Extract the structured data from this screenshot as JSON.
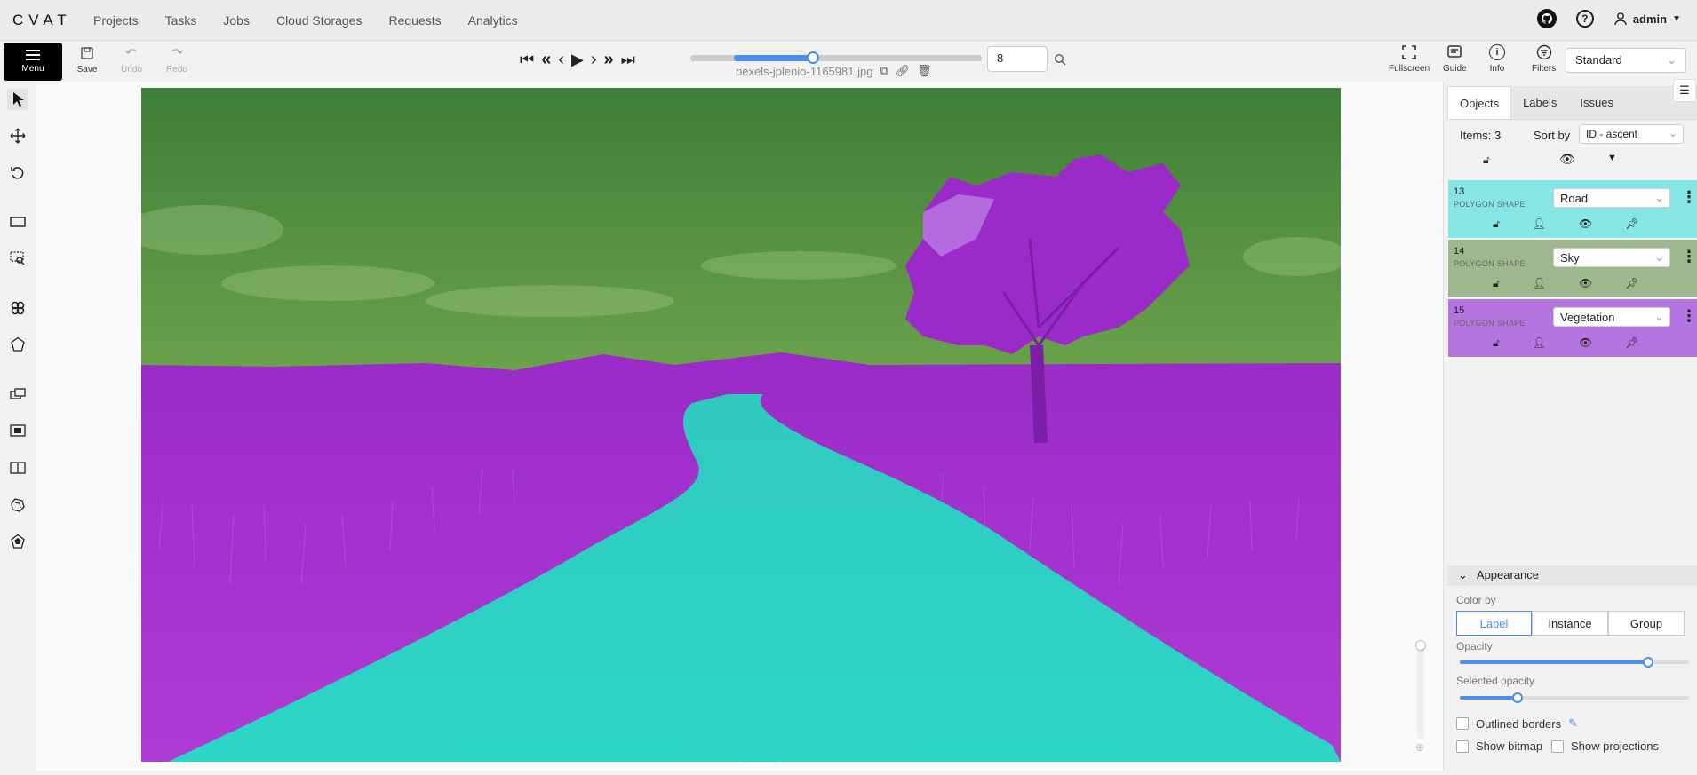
{
  "app": {
    "logo": "CVAT"
  },
  "nav": {
    "items": [
      "Projects",
      "Tasks",
      "Jobs",
      "Cloud Storages",
      "Requests",
      "Analytics"
    ],
    "user": "admin"
  },
  "toolbar": {
    "menu_label": "Menu",
    "save_label": "Save",
    "undo_label": "Undo",
    "redo_label": "Redo",
    "frame_number": "8",
    "filename": "pexels-jplenio-1165981.jpg",
    "frame_progress": 0.42,
    "fullscreen_label": "Fullscreen",
    "guide_label": "Guide",
    "info_label": "Info",
    "filters_label": "Filters",
    "workspace": "Standard"
  },
  "sidebar": {
    "tabs": [
      "Objects",
      "Labels",
      "Issues"
    ],
    "items_count": "Items: 3",
    "sort_label": "Sort by",
    "sort_value": "ID - ascent",
    "objects": [
      {
        "id": "13",
        "type": "POLYGON SHAPE",
        "label": "Road",
        "color": "#86e6e6"
      },
      {
        "id": "14",
        "type": "POLYGON SHAPE",
        "label": "Sky",
        "color": "#9db88f"
      },
      {
        "id": "15",
        "type": "POLYGON SHAPE",
        "label": "Vegetation",
        "color": "#b475e0"
      }
    ]
  },
  "appearance": {
    "title": "Appearance",
    "color_by_label": "Color by",
    "color_by_options": [
      "Label",
      "Instance",
      "Group"
    ],
    "color_by_selected": "Label",
    "opacity_label": "Opacity",
    "opacity_value": 0.82,
    "selected_opacity_label": "Selected opacity",
    "selected_opacity_value": 0.25,
    "outlined_borders": "Outlined borders",
    "show_bitmap": "Show bitmap",
    "show_projections": "Show projections"
  },
  "colors": {
    "road": "#2ed1c4",
    "sky": "#4e9a3a",
    "vegetation": "#9b2ac8",
    "accent": "#4b8ef2"
  }
}
